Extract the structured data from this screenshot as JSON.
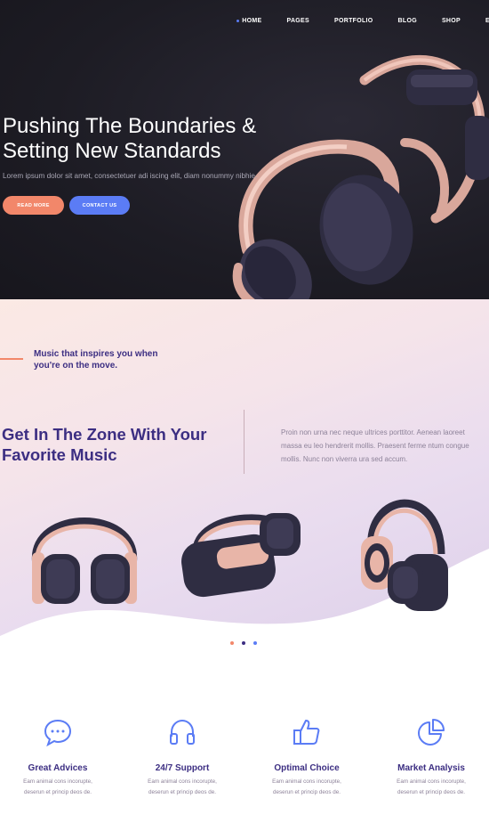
{
  "nav": {
    "items": [
      {
        "label": "HOME"
      },
      {
        "label": "PAGES"
      },
      {
        "label": "PORTFOLIO"
      },
      {
        "label": "BLOG"
      },
      {
        "label": "SHOP"
      },
      {
        "label": "E"
      }
    ]
  },
  "hero": {
    "title": "Pushing The Boundaries & Setting New Standards",
    "subtitle": "Lorem ipsum dolor sit amet, consectetuer adi iscing elit, diam nonummy nibhie.",
    "read_more": "READ MORE",
    "contact_us": "CONTACT US"
  },
  "music": {
    "tagline": "Music that inspires you when you're on the move.",
    "title": "Get In The Zone With Your Favorite Music",
    "text": "Proin non urna nec neque ultrices porttitor. Aenean laoreet massa eu leo hendrerit mollis. Praesent ferme ntum congue mollis. Nunc non viverra ura sed accum."
  },
  "features": [
    {
      "icon": "chat-bubble-icon",
      "title": "Great Advices",
      "desc1": "Eam animal cons incorupte,",
      "desc2": "deserun et princip deos de."
    },
    {
      "icon": "headphones-icon",
      "title": "24/7 Support",
      "desc1": "Eam animal cons incorupte,",
      "desc2": "deserun et princip deos de."
    },
    {
      "icon": "thumbs-up-icon",
      "title": "Optimal Choice",
      "desc1": "Eam animal cons incorupte,",
      "desc2": "deserun et princip deos de."
    },
    {
      "icon": "pie-chart-icon",
      "title": "Market Analysis",
      "desc1": "Eam animal cons incorupte,",
      "desc2": "deserun et princip deos de."
    }
  ],
  "colors": {
    "accent_blue": "#5b7cf5",
    "accent_orange": "#f2876a",
    "heading_purple": "#3c2e82",
    "hero_bg": "#1d1c24",
    "headphone_pink": "#e8b5a8",
    "headphone_navy": "#2f2d42"
  }
}
